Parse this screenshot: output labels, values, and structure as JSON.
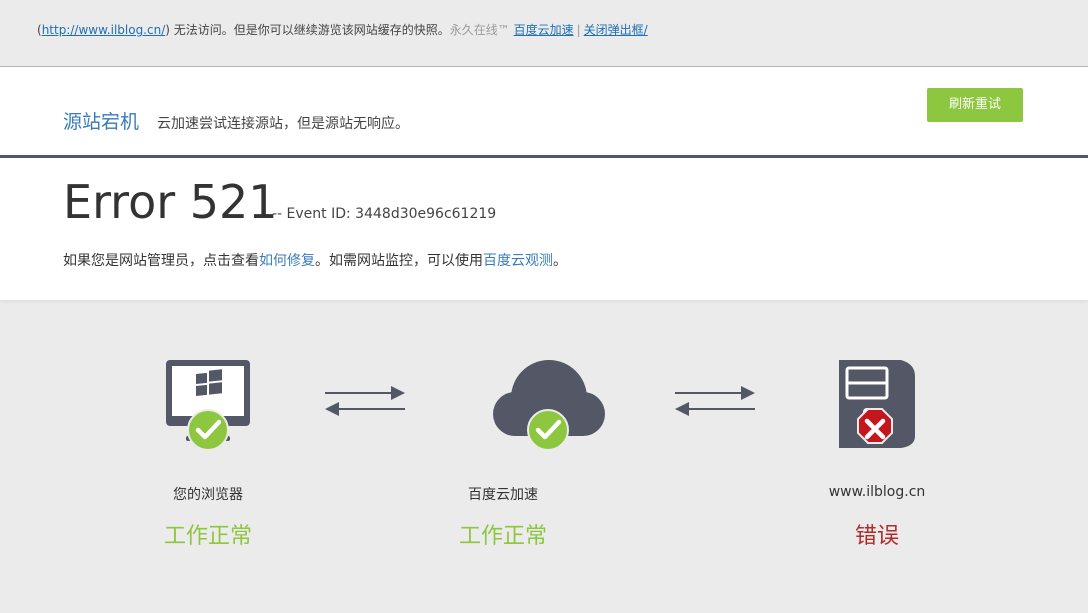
{
  "notice": {
    "url_text": "http://www.ilblog.cn/",
    "open_paren": "(",
    "close_paren_message": ") 无法访问。但是你可以继续游览该网站缓存的快照。",
    "always_online": "永久在线™",
    "link_baidu_accel": "百度云加速",
    "separator": "|",
    "link_close_popup": "关闭弹出框/"
  },
  "header": {
    "status_title": "源站宕机",
    "status_desc": "云加速尝试连接源站，但是源站无响应。",
    "retry_label": "刷新重试"
  },
  "error": {
    "code": "Error 521",
    "event_id": "-- Event ID: 3448d30e96c61219",
    "hint_prefix": "如果您是网站管理员，点击查看",
    "hint_link_fix": "如何修复",
    "hint_middle": "。如需网站监控，可以使用",
    "hint_link_monitor": "百度云观测",
    "hint_suffix": "。"
  },
  "diagram": {
    "nodes": [
      {
        "label": "您的浏览器",
        "status": "工作正常",
        "state": "ok",
        "icon": "browser-monitor-icon"
      },
      {
        "label": "百度云加速",
        "status": "工作正常",
        "state": "ok",
        "icon": "cloud-icon"
      },
      {
        "label": "www.ilblog.cn",
        "status": "错误",
        "state": "error",
        "icon": "server-icon"
      }
    ]
  },
  "colors": {
    "ok": "#8dc63f",
    "error": "#b22a2a",
    "link": "#3a7cb8",
    "icon_dark": "#535766",
    "header_border": "#4b5a6e"
  }
}
